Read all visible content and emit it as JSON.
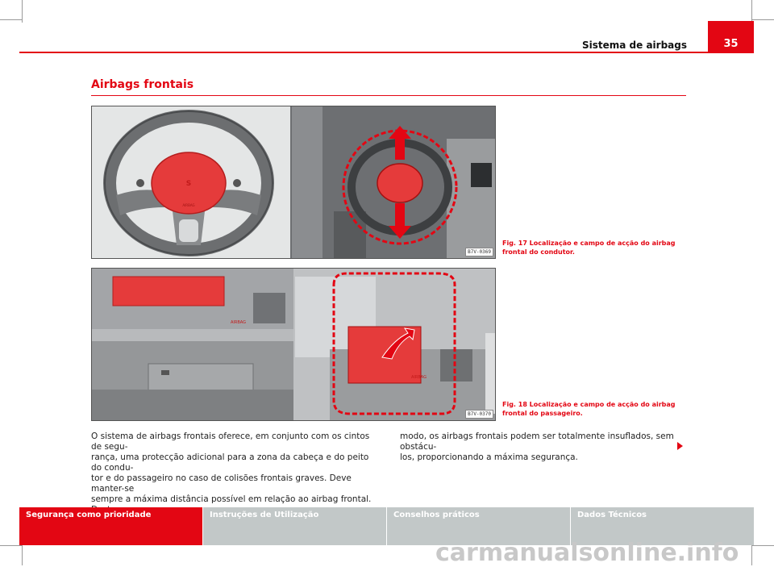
{
  "header": {
    "running_title": "Sistema de airbags",
    "page_number": "35"
  },
  "section": {
    "title": "Airbags frontais"
  },
  "figures": [
    {
      "code_left": "B7V-0369",
      "caption": "Fig. 17  Localização e campo de acção do airbag frontal do condutor."
    },
    {
      "code_left": "B7V-0370",
      "caption": "Fig. 18  Localização e campo de acção do airbag frontal do passageiro."
    }
  ],
  "body": {
    "col1": [
      "O sistema de airbags frontais oferece, em conjunto com os cintos de segu-",
      "rança, uma protecção adicional para a zona da cabeça e do peito do condu-",
      "tor e do passageiro no caso de colisões frontais graves. Deve manter-se",
      "sempre a máxima distância possível em relação ao airbag frontal. Deste"
    ],
    "col2": [
      "modo, os airbags frontais podem ser totalmente insuflados, sem obstácu-",
      "los, proporcionando a máxima segurança."
    ]
  },
  "tabs": [
    {
      "label": "Segurança como prioridade",
      "active": true
    },
    {
      "label": "Instruções de Utilização",
      "active": false
    },
    {
      "label": "Conselhos práticos",
      "active": false
    },
    {
      "label": "Dados Técnicos",
      "active": false
    }
  ],
  "labels": {
    "airbag_text": "AIRBAG",
    "airbag_text2": "AIRBAG"
  },
  "watermark": "carmanualsonline.info",
  "colors": {
    "accent": "#e30613",
    "tab_inactive": "#c2c8c8"
  }
}
